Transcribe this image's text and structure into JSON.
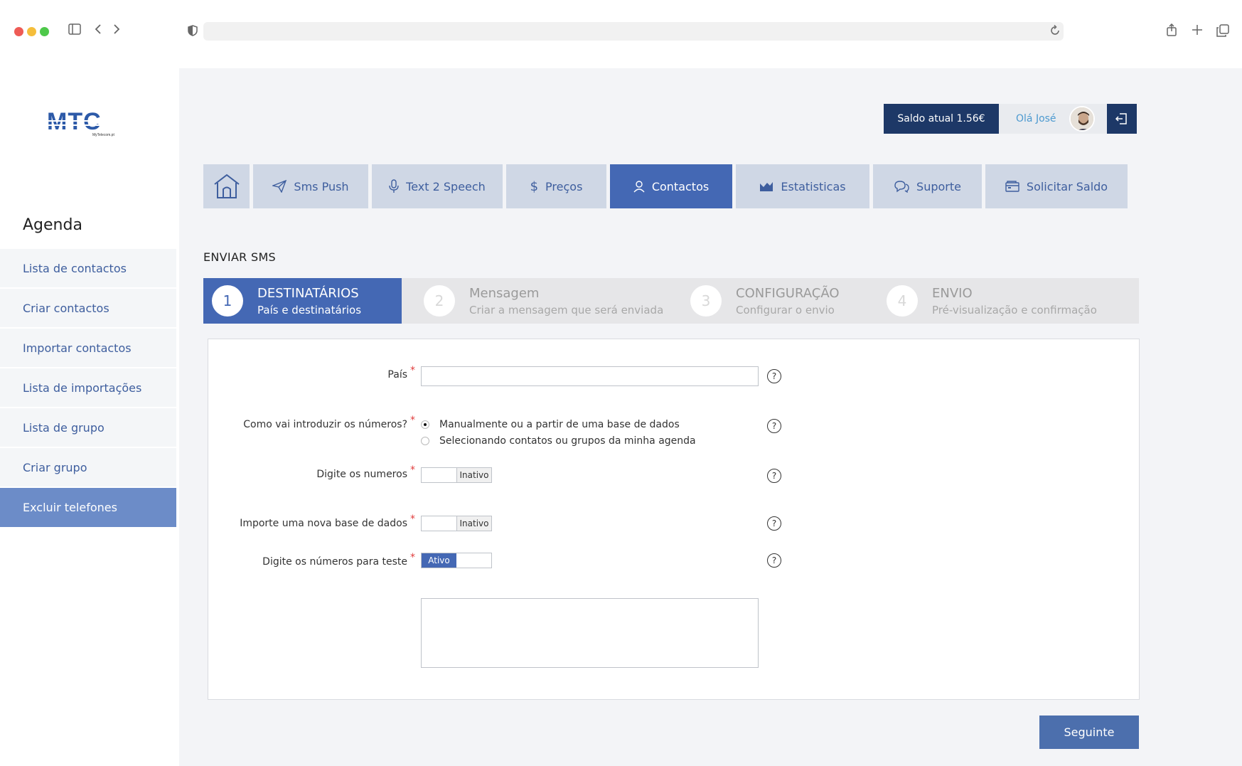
{
  "brand": {
    "logo_text": "MTC",
    "logo_sub": "MyTelecom.pt"
  },
  "sidebar": {
    "title": "Agenda",
    "items": [
      {
        "label": "Lista de contactos"
      },
      {
        "label": "Criar contactos"
      },
      {
        "label": "Importar contactos"
      },
      {
        "label": "Lista de importações"
      },
      {
        "label": "Lista de grupo"
      },
      {
        "label": "Criar grupo"
      },
      {
        "label": "Excluir telefones"
      }
    ]
  },
  "header": {
    "balance": "Saldo atual 1.56€",
    "greeting": "Olá José"
  },
  "nav": {
    "items": [
      {
        "label": "Sms Push"
      },
      {
        "label": "Text 2 Speech"
      },
      {
        "label": "Preços"
      },
      {
        "label": "Contactos"
      },
      {
        "label": "Estatisticas"
      },
      {
        "label": "Suporte"
      },
      {
        "label": "Solicitar Saldo"
      }
    ]
  },
  "section": {
    "title": "ENVIAR SMS"
  },
  "steps": [
    {
      "num": "1",
      "title": "DESTINATÁRIOS",
      "sub": "País e destinatários"
    },
    {
      "num": "2",
      "title": "Mensagem",
      "sub": "Criar a mensagem que será enviada"
    },
    {
      "num": "3",
      "title": "CONFIGURAÇÃO",
      "sub": "Configurar o envio"
    },
    {
      "num": "4",
      "title": "ENVIO",
      "sub": "Pré-visualização e confirmação"
    }
  ],
  "form": {
    "country_label": "País",
    "input_method_label": "Como vai introduzir os números?",
    "input_method_options": [
      "Manualmente ou a partir de uma base de dados",
      "Selecionando contatos ou grupos da minha agenda"
    ],
    "type_numbers_label": "Digite os numeros",
    "type_numbers_state": "Inativo",
    "import_db_label": "Importe uma nova base de dados",
    "import_db_state": "Inativo",
    "test_numbers_label": "Digite os números para teste",
    "test_numbers_state": "Ativo",
    "required_mark": "*",
    "help_mark": "?"
  },
  "actions": {
    "next": "Seguinte"
  },
  "colors": {
    "primary": "#4468b4",
    "dark": "#1d3867",
    "accent_blue": "#4d9ad0",
    "required": "#e03c3c"
  }
}
